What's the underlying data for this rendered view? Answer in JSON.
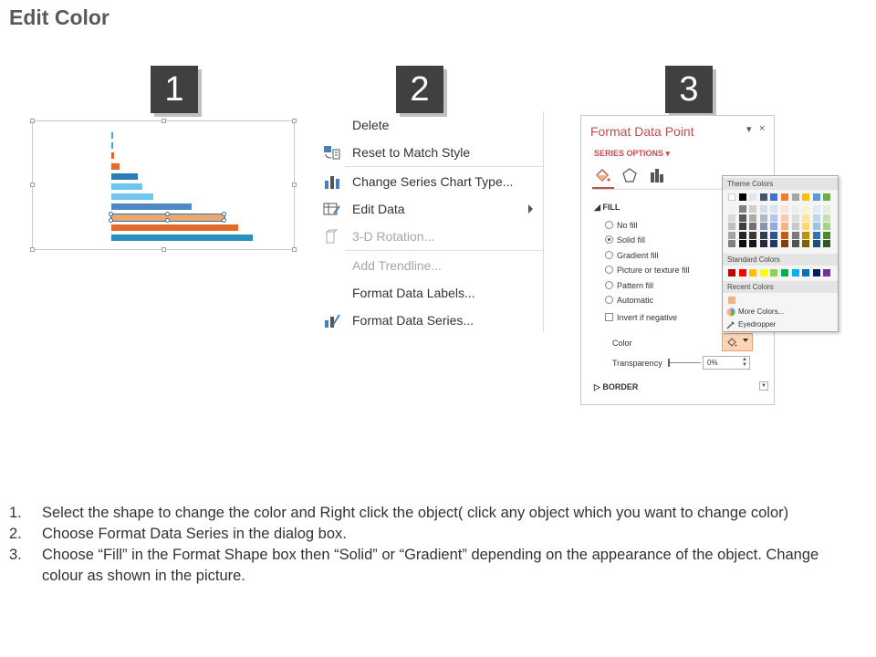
{
  "page": {
    "title": "Edit Color"
  },
  "steps": [
    "1",
    "2",
    "3"
  ],
  "chart": {
    "bars": [
      {
        "color": "#4aa3d8",
        "value": 1,
        "dashed": true
      },
      {
        "color": "#4aa3d8",
        "value": 1,
        "dashed": true
      },
      {
        "color": "#e06c2b",
        "value": 2
      },
      {
        "color": "#e06c2b",
        "value": 5
      },
      {
        "color": "#2e7cb5",
        "value": 17
      },
      {
        "color": "#6ec6f0",
        "value": 20
      },
      {
        "color": "#6ec6f0",
        "value": 27
      },
      {
        "color": "#4e88c7",
        "value": 52
      },
      {
        "color": "#e8a870",
        "value": 73,
        "selected": true
      },
      {
        "color": "#e06c2b",
        "value": 82
      },
      {
        "color": "#2a8fbf",
        "value": 91
      }
    ]
  },
  "context_menu": {
    "items": [
      {
        "label": "Delete",
        "icon": "",
        "enabled": true
      },
      {
        "label": "Reset to Match Style",
        "icon": "reset-style-icon",
        "enabled": true
      },
      {
        "label": "Change Series Chart Type...",
        "icon": "chart-type-icon",
        "enabled": true
      },
      {
        "label": "Edit Data",
        "icon": "edit-data-icon",
        "enabled": true,
        "submenu": true
      },
      {
        "label": "3-D Rotation...",
        "icon": "3d-rotation-icon",
        "enabled": false
      },
      {
        "label": "Add Trendline...",
        "icon": "",
        "enabled": false
      },
      {
        "label": "Format Data Labels...",
        "icon": "",
        "enabled": true
      },
      {
        "label": "Format Data Series...",
        "icon": "format-series-icon",
        "enabled": true
      }
    ]
  },
  "format_pane": {
    "title": "Format Data Point",
    "dropdown": "▾",
    "close": "×",
    "series_options": "SERIES OPTIONS ▾",
    "fill_section": "◢ FILL",
    "fill_options": [
      {
        "label": "No fill",
        "selected": false
      },
      {
        "label": "Solid fill",
        "selected": true
      },
      {
        "label": "Gradient fill",
        "selected": false
      },
      {
        "label": "Picture or texture fill",
        "selected": false
      },
      {
        "label": "Pattern fill",
        "selected": false
      },
      {
        "label": "Automatic",
        "selected": false
      }
    ],
    "invert_label": "Invert if negative",
    "color_label": "Color",
    "transparency_label": "Transparency",
    "transparency_value": "0%",
    "border_section": "▷ BORDER",
    "accent_color": "#c0504d"
  },
  "palette": {
    "theme_colors_label": "Theme Colors",
    "standard_colors_label": "Standard Colors",
    "recent_colors_label": "Recent Colors",
    "more_colors_label": "More Colors...",
    "eyedropper_label": "Eyedropper",
    "theme_top": [
      "#ffffff",
      "#000000",
      "#e7e6e6",
      "#44546a",
      "#4472c4",
      "#ed7d31",
      "#a5a5a5",
      "#ffc000",
      "#5b9bd5",
      "#70ad47"
    ],
    "theme_shades": [
      [
        "#f2f2f2",
        "#7f7f7f",
        "#d0cece",
        "#d6dce4",
        "#d9e2f3",
        "#fbe5d5",
        "#ededed",
        "#fff2cc",
        "#deebf6",
        "#e2efd9"
      ],
      [
        "#d8d8d8",
        "#595959",
        "#aeabab",
        "#adb9ca",
        "#b4c6e7",
        "#f7cbac",
        "#dbdbdb",
        "#fee599",
        "#bdd7ee",
        "#c5e0b3"
      ],
      [
        "#bfbfbf",
        "#3f3f3f",
        "#757070",
        "#8496b0",
        "#8eaadb",
        "#f4b183",
        "#c9c9c9",
        "#ffd965",
        "#9cc3e5",
        "#a8d08d"
      ],
      [
        "#a5a5a5",
        "#262626",
        "#3a3838",
        "#323f4f",
        "#2f5496",
        "#c55a11",
        "#7b7b7b",
        "#bf9000",
        "#2e75b5",
        "#538135"
      ],
      [
        "#7f7f7f",
        "#0c0c0c",
        "#171616",
        "#222a35",
        "#1f3864",
        "#833c0b",
        "#525252",
        "#7f6000",
        "#1e4e79",
        "#375623"
      ]
    ],
    "standard": [
      "#c00000",
      "#ff0000",
      "#ffc000",
      "#ffff00",
      "#92d050",
      "#00b050",
      "#00b0f0",
      "#0070c0",
      "#002060",
      "#7030a0"
    ],
    "recent": [
      "#f4b183"
    ]
  },
  "instructions": [
    {
      "num": "1.",
      "text": "Select the shape to change the color and Right click the object( click any object which you want to change color)"
    },
    {
      "num": "2.",
      "text": "Choose Format Data Series in the dialog box."
    },
    {
      "num": "3.",
      "text": "Choose “Fill” in the Format Shape box then “Solid” or “Gradient” depending on the appearance of the object. Change colour as shown in the picture."
    }
  ]
}
